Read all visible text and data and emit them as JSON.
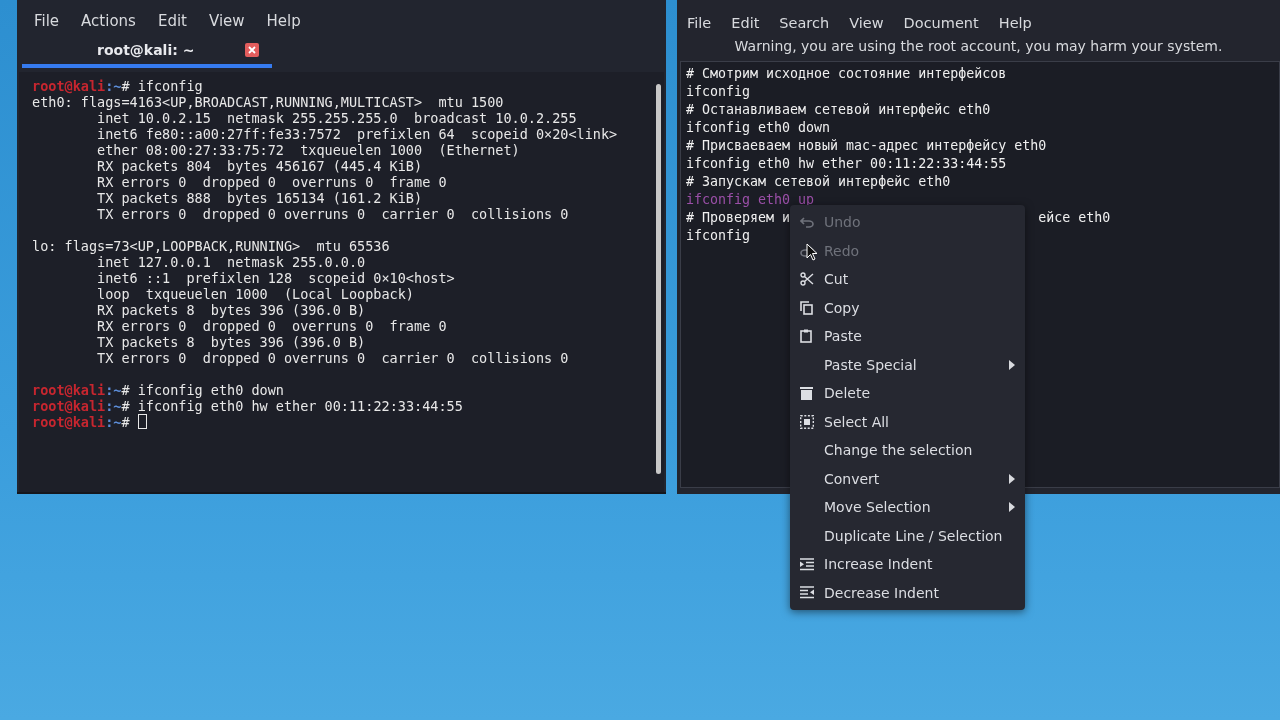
{
  "terminal": {
    "menu": [
      "File",
      "Actions",
      "Edit",
      "View",
      "Help"
    ],
    "tabs": [
      {
        "label": "root@kali: ~",
        "selected": true
      }
    ],
    "lines": [
      {
        "kind": "prompt",
        "user": "root@kali",
        "path": ":~",
        "command": "# ifconfig",
        "cursor": false
      },
      {
        "kind": "output",
        "text": "eth0: flags=4163<UP,BROADCAST,RUNNING,MULTICAST>  mtu 1500"
      },
      {
        "kind": "output",
        "text": "        inet 10.0.2.15  netmask 255.255.255.0  broadcast 10.0.2.255"
      },
      {
        "kind": "output",
        "text": "        inet6 fe80::a00:27ff:fe33:7572  prefixlen 64  scopeid 0×20<link>"
      },
      {
        "kind": "output",
        "text": "        ether 08:00:27:33:75:72  txqueuelen 1000  (Ethernet)"
      },
      {
        "kind": "output",
        "text": "        RX packets 804  bytes 456167 (445.4 KiB)"
      },
      {
        "kind": "output",
        "text": "        RX errors 0  dropped 0  overruns 0  frame 0"
      },
      {
        "kind": "output",
        "text": "        TX packets 888  bytes 165134 (161.2 KiB)"
      },
      {
        "kind": "output",
        "text": "        TX errors 0  dropped 0 overruns 0  carrier 0  collisions 0"
      },
      {
        "kind": "blank"
      },
      {
        "kind": "output",
        "text": "lo: flags=73<UP,LOOPBACK,RUNNING>  mtu 65536"
      },
      {
        "kind": "output",
        "text": "        inet 127.0.0.1  netmask 255.0.0.0"
      },
      {
        "kind": "output",
        "text": "        inet6 ::1  prefixlen 128  scopeid 0×10<host>"
      },
      {
        "kind": "output",
        "text": "        loop  txqueuelen 1000  (Local Loopback)"
      },
      {
        "kind": "output",
        "text": "        RX packets 8  bytes 396 (396.0 B)"
      },
      {
        "kind": "output",
        "text": "        RX errors 0  dropped 0  overruns 0  frame 0"
      },
      {
        "kind": "output",
        "text": "        TX packets 8  bytes 396 (396.0 B)"
      },
      {
        "kind": "output",
        "text": "        TX errors 0  dropped 0 overruns 0  carrier 0  collisions 0"
      },
      {
        "kind": "blank"
      },
      {
        "kind": "prompt",
        "user": "root@kali",
        "path": ":~",
        "command": "# ifconfig eth0 down",
        "cursor": false
      },
      {
        "kind": "prompt",
        "user": "root@kali",
        "path": ":~",
        "command": "# ifconfig eth0 hw ether 00:11:22:33:44:55",
        "cursor": false
      },
      {
        "kind": "prompt",
        "user": "root@kali",
        "path": ":~",
        "command": "#",
        "cursor": true
      }
    ]
  },
  "editor": {
    "menu": [
      "File",
      "Edit",
      "Search",
      "View",
      "Document",
      "Help"
    ],
    "warning": "Warning, you are using the root account, you may harm your system.",
    "lines": [
      {
        "text": "# Смотрим исходное состояние интерфейсов",
        "selected": false
      },
      {
        "text": "ifconfig",
        "selected": false
      },
      {
        "text": "# Останавливаем сетевой интерфейс eth0",
        "selected": false
      },
      {
        "text": "ifconfig eth0 down",
        "selected": false
      },
      {
        "text": "# Присваеваем новый mac-адрес интерфейсу eth0",
        "selected": false
      },
      {
        "text": "ifconfig eth0 hw ether 00:11:22:33:44:55",
        "selected": false
      },
      {
        "text": "# Запускам сетевой интерфейс eth0",
        "selected": false
      },
      {
        "text": "ifconfig eth0 up",
        "selected": true
      },
      {
        "text": "# Проверяем и",
        "tail": "ейсе eth0",
        "selected": false
      },
      {
        "text": "ifconfig",
        "selected": false
      }
    ]
  },
  "context_menu": [
    {
      "label": "Undo",
      "kind": "undo",
      "disabled": true,
      "submenu": false
    },
    {
      "label": "Redo",
      "kind": "redo",
      "disabled": true,
      "submenu": false
    },
    {
      "label": "Cut",
      "kind": "cut",
      "disabled": false,
      "submenu": false
    },
    {
      "label": "Copy",
      "kind": "copy",
      "disabled": false,
      "submenu": false
    },
    {
      "label": "Paste",
      "kind": "paste",
      "disabled": false,
      "submenu": false
    },
    {
      "label": "Paste Special",
      "kind": "plain",
      "disabled": false,
      "submenu": true
    },
    {
      "label": "Delete",
      "kind": "delete",
      "disabled": false,
      "submenu": false
    },
    {
      "label": "Select All",
      "kind": "selectall",
      "disabled": false,
      "submenu": false
    },
    {
      "label": "Change the selection",
      "kind": "plain",
      "disabled": false,
      "submenu": false
    },
    {
      "label": "Convert",
      "kind": "plain",
      "disabled": false,
      "submenu": true
    },
    {
      "label": "Move Selection",
      "kind": "plain",
      "disabled": false,
      "submenu": true
    },
    {
      "label": "Duplicate Line / Selection",
      "kind": "plain",
      "disabled": false,
      "submenu": false
    },
    {
      "label": "Increase Indent",
      "kind": "indent",
      "disabled": false,
      "submenu": false
    },
    {
      "label": "Decrease Indent",
      "kind": "outdent",
      "disabled": false,
      "submenu": false
    }
  ]
}
